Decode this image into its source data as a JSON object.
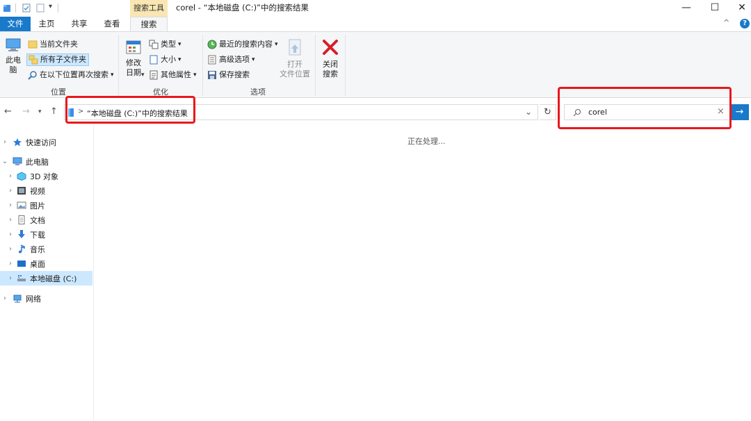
{
  "title_bar": {
    "contextual_tab": "搜索工具",
    "window_title": "corel - “本地磁盘 (C:)”中的搜索结果",
    "minimize": "—",
    "maximize": "☐",
    "close": "✕"
  },
  "ribbon_tabs": {
    "file": "文件",
    "home": "主页",
    "share": "共享",
    "view": "查看",
    "search": "搜索",
    "collapse": "^",
    "help": "?"
  },
  "ribbon": {
    "location": {
      "this_pc_line1": "此电",
      "this_pc_line2": "脑",
      "current_folder": "当前文件夹",
      "all_subfolders": "所有子文件夹",
      "search_again": "在以下位置再次搜索",
      "group_label": "位置"
    },
    "refine": {
      "date_line1": "修改",
      "date_line2": "日期",
      "kind": "类型",
      "size": "大小",
      "other_props": "其他属性",
      "group_label": "优化"
    },
    "options": {
      "recent_searches": "最近的搜索内容",
      "advanced": "高级选项",
      "save_search": "保存搜索",
      "open_loc_line1": "打开",
      "open_loc_line2": "文件位置",
      "close_line1": "关闭",
      "close_line2": "搜索",
      "group_label": "选项"
    }
  },
  "address_bar": {
    "path": "“本地磁盘 (C:)”中的搜索结果",
    "separator": ">",
    "dropdown": "⌄",
    "refresh": "↻"
  },
  "search_box": {
    "value": "corel",
    "clear": "×",
    "go": "→"
  },
  "nav_pane": {
    "items": [
      {
        "label": "快速访问",
        "icon": "star-icon"
      },
      {
        "label": "此电脑",
        "icon": "computer-icon"
      },
      {
        "label": "3D 对象",
        "icon": "cube-icon"
      },
      {
        "label": "视频",
        "icon": "video-icon"
      },
      {
        "label": "图片",
        "icon": "picture-icon"
      },
      {
        "label": "文档",
        "icon": "document-icon"
      },
      {
        "label": "下载",
        "icon": "download-icon"
      },
      {
        "label": "音乐",
        "icon": "music-icon"
      },
      {
        "label": "桌面",
        "icon": "desktop-icon"
      },
      {
        "label": "本地磁盘 (C:)",
        "icon": "drive-icon"
      },
      {
        "label": "网络",
        "icon": "network-icon"
      }
    ]
  },
  "content": {
    "status": "正在处理..."
  },
  "colors": {
    "accent": "#1979ca",
    "annotation": "#e8171c",
    "contextual_tab_bg": "#f9e6b3",
    "selected_nav_bg": "#cce8ff"
  }
}
